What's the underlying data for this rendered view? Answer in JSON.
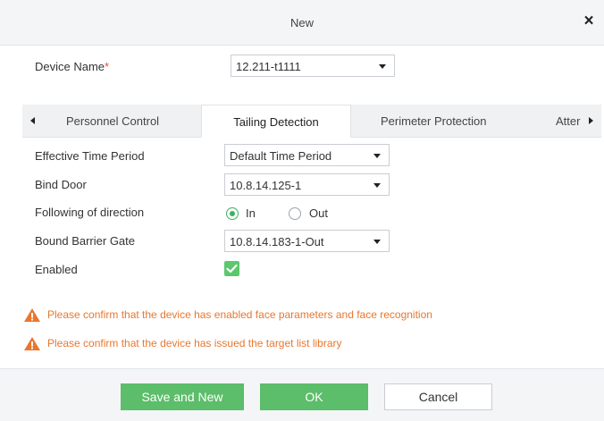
{
  "dialog": {
    "title": "New",
    "close_glyph": "×"
  },
  "device_name": {
    "label": "Device Name",
    "required_mark": "*",
    "value": "12.211-t1111"
  },
  "tabs": [
    {
      "label": "Personnel Control",
      "active": false
    },
    {
      "label": "Tailing Detection",
      "active": true
    },
    {
      "label": "Perimeter Protection",
      "active": false
    },
    {
      "label": "Atter",
      "active": false
    }
  ],
  "form": {
    "effective_time_period": {
      "label": "Effective Time Period",
      "value": "Default Time Period"
    },
    "bind_door": {
      "label": "Bind Door",
      "value": "10.8.14.125-1"
    },
    "following_direction": {
      "label": "Following of direction",
      "options": [
        "In",
        "Out"
      ],
      "selected": "In"
    },
    "bound_barrier_gate": {
      "label": "Bound Barrier Gate",
      "value": "10.8.14.183-1-Out"
    },
    "enabled": {
      "label": "Enabled",
      "checked": true
    }
  },
  "warnings": [
    "Please confirm that the device has enabled face parameters and face recognition",
    "Please confirm that the device has issued the target list library"
  ],
  "buttons": {
    "save_and_new": "Save and New",
    "ok": "OK",
    "cancel": "Cancel"
  },
  "colors": {
    "accent_green": "#5cbd6a",
    "warning_orange": "#e8772e",
    "required_red": "#e84c3d"
  },
  "icons": {
    "close": "close-icon",
    "warning": "warning-icon",
    "caret": "chevron-down-icon",
    "check": "check-icon"
  }
}
